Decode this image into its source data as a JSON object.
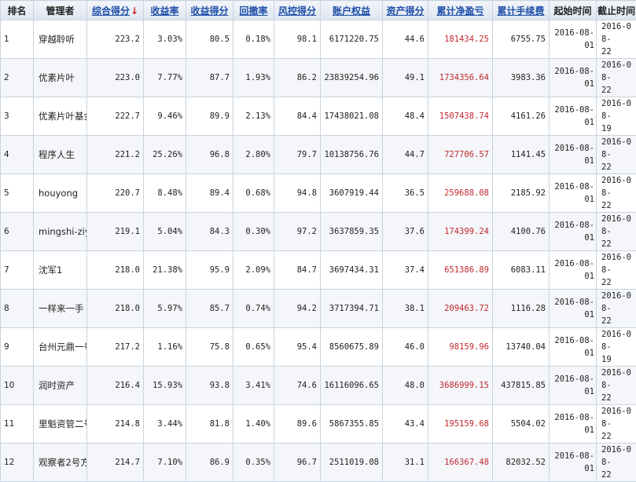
{
  "headers": {
    "rank": "排名",
    "manager": "管理者",
    "total_score": "综合得分",
    "sort_arrow": "↓",
    "return_rate": "收益率",
    "return_score": "收益得分",
    "drawdown": "回撤率",
    "risk_score": "风控得分",
    "equity": "账户权益",
    "asset_score": "资产得分",
    "net_pnl": "累计净盈亏",
    "fees": "累计手续费",
    "start_time": "起始时间",
    "end_time": "截止时间"
  },
  "rows": [
    {
      "rank": "1",
      "manager": "穿越聆听",
      "total_score": "223.2",
      "return_rate": "3.03%",
      "return_score": "80.5",
      "drawdown": "0.18%",
      "risk_score": "98.1",
      "equity": "6171220.75",
      "asset_score": "44.6",
      "net_pnl": "181434.25",
      "fees": "6755.75",
      "start_a": "2016-08-",
      "start_b": "01",
      "end_a": "2016-08-",
      "end_b": "22"
    },
    {
      "rank": "2",
      "manager": "优素片叶",
      "total_score": "223.0",
      "return_rate": "7.77%",
      "return_score": "87.7",
      "drawdown": "1.93%",
      "risk_score": "86.2",
      "equity": "23839254.96",
      "asset_score": "49.1",
      "net_pnl": "1734356.64",
      "fees": "3983.36",
      "start_a": "2016-08-",
      "start_b": "01",
      "end_a": "2016-08-",
      "end_b": "22"
    },
    {
      "rank": "3",
      "manager": "优素片叶基金",
      "total_score": "222.7",
      "return_rate": "9.46%",
      "return_score": "89.9",
      "drawdown": "2.13%",
      "risk_score": "84.4",
      "equity": "17438021.08",
      "asset_score": "48.4",
      "net_pnl": "1507438.74",
      "fees": "4161.26",
      "start_a": "2016-08-",
      "start_b": "01",
      "end_a": "2016-08-",
      "end_b": "19"
    },
    {
      "rank": "4",
      "manager": "程序人生",
      "total_score": "221.2",
      "return_rate": "25.26%",
      "return_score": "96.8",
      "drawdown": "2.80%",
      "risk_score": "79.7",
      "equity": "10138756.76",
      "asset_score": "44.7",
      "net_pnl": "727706.57",
      "fees": "1141.45",
      "start_a": "2016-08-",
      "start_b": "01",
      "end_a": "2016-08-",
      "end_b": "22"
    },
    {
      "rank": "5",
      "manager": "houyong",
      "total_score": "220.7",
      "return_rate": "8.48%",
      "return_score": "89.4",
      "drawdown": "0.68%",
      "risk_score": "94.8",
      "equity": "3607919.44",
      "asset_score": "36.5",
      "net_pnl": "259688.08",
      "fees": "2185.92",
      "start_a": "2016-08-",
      "start_b": "01",
      "end_a": "2016-08-",
      "end_b": "22"
    },
    {
      "rank": "6",
      "manager": "mingshi-ziyi",
      "total_score": "219.1",
      "return_rate": "5.04%",
      "return_score": "84.3",
      "drawdown": "0.30%",
      "risk_score": "97.2",
      "equity": "3637859.35",
      "asset_score": "37.6",
      "net_pnl": "174399.24",
      "fees": "4100.76",
      "start_a": "2016-08-",
      "start_b": "01",
      "end_a": "2016-08-",
      "end_b": "22"
    },
    {
      "rank": "7",
      "manager": "沈军1",
      "total_score": "218.0",
      "return_rate": "21.38%",
      "return_score": "95.9",
      "drawdown": "2.09%",
      "risk_score": "84.7",
      "equity": "3697434.31",
      "asset_score": "37.4",
      "net_pnl": "651386.89",
      "fees": "6083.11",
      "start_a": "2016-08-",
      "start_b": "01",
      "end_a": "2016-08-",
      "end_b": "22"
    },
    {
      "rank": "8",
      "manager": "一样来一手",
      "total_score": "218.0",
      "return_rate": "5.97%",
      "return_score": "85.7",
      "drawdown": "0.74%",
      "risk_score": "94.2",
      "equity": "3717394.71",
      "asset_score": "38.1",
      "net_pnl": "209463.72",
      "fees": "1116.28",
      "start_a": "2016-08-",
      "start_b": "01",
      "end_a": "2016-08-",
      "end_b": "22"
    },
    {
      "rank": "9",
      "manager": "台州元鼎一号",
      "total_score": "217.2",
      "return_rate": "1.16%",
      "return_score": "75.8",
      "drawdown": "0.65%",
      "risk_score": "95.4",
      "equity": "8560675.89",
      "asset_score": "46.0",
      "net_pnl": "98159.96",
      "fees": "13740.04",
      "start_a": "2016-08-",
      "start_b": "01",
      "end_a": "2016-08-",
      "end_b": "19"
    },
    {
      "rank": "10",
      "manager": "润时资产",
      "total_score": "216.4",
      "return_rate": "15.93%",
      "return_score": "93.8",
      "drawdown": "3.41%",
      "risk_score": "74.6",
      "equity": "16116096.65",
      "asset_score": "48.0",
      "net_pnl": "3686999.15",
      "fees": "437815.85",
      "start_a": "2016-08-",
      "start_b": "01",
      "end_a": "2016-08-",
      "end_b": "22"
    },
    {
      "rank": "11",
      "manager": "里魁资管二号",
      "total_score": "214.8",
      "return_rate": "3.44%",
      "return_score": "81.8",
      "drawdown": "1.40%",
      "risk_score": "89.6",
      "equity": "5867355.85",
      "asset_score": "43.4",
      "net_pnl": "195159.68",
      "fees": "5504.02",
      "start_a": "2016-08-",
      "start_b": "01",
      "end_a": "2016-08-",
      "end_b": "22"
    },
    {
      "rank": "12",
      "manager": "观察者2号方",
      "total_score": "214.7",
      "return_rate": "7.10%",
      "return_score": "86.9",
      "drawdown": "0.35%",
      "risk_score": "96.7",
      "equity": "2511019.08",
      "asset_score": "31.1",
      "net_pnl": "166367.48",
      "fees": "82032.52",
      "start_a": "2016-08-",
      "start_b": "01",
      "end_a": "2016-08-",
      "end_b": "22"
    }
  ],
  "colors": {
    "pnl": "#c0272d",
    "header_link": "#1f4fa8",
    "sort_arrow": "#d42020",
    "border": "#c8d3e0"
  }
}
